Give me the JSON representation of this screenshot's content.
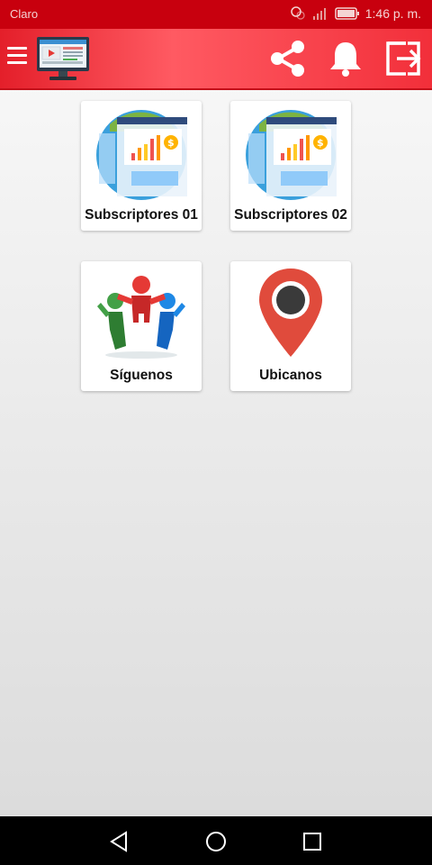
{
  "status_bar": {
    "carrier": "Claro",
    "time": "1:46 p. m."
  },
  "app_bar": {
    "icons": [
      "menu-icon",
      "monitor-logo",
      "share-icon",
      "bell-icon",
      "exit-icon"
    ],
    "color": "#e41f2a"
  },
  "menu": {
    "items": [
      {
        "label": "Subscriptores 01",
        "icon": "dashboard-chart-icon"
      },
      {
        "label": "Subscriptores 02",
        "icon": "dashboard-chart-icon"
      },
      {
        "label": "Síguenos",
        "icon": "people-group-icon"
      },
      {
        "label": "Ubicanos",
        "icon": "location-pin-icon"
      }
    ]
  },
  "nav_bar": {
    "icons": [
      "back-icon",
      "home-icon",
      "recent-apps-icon"
    ]
  }
}
